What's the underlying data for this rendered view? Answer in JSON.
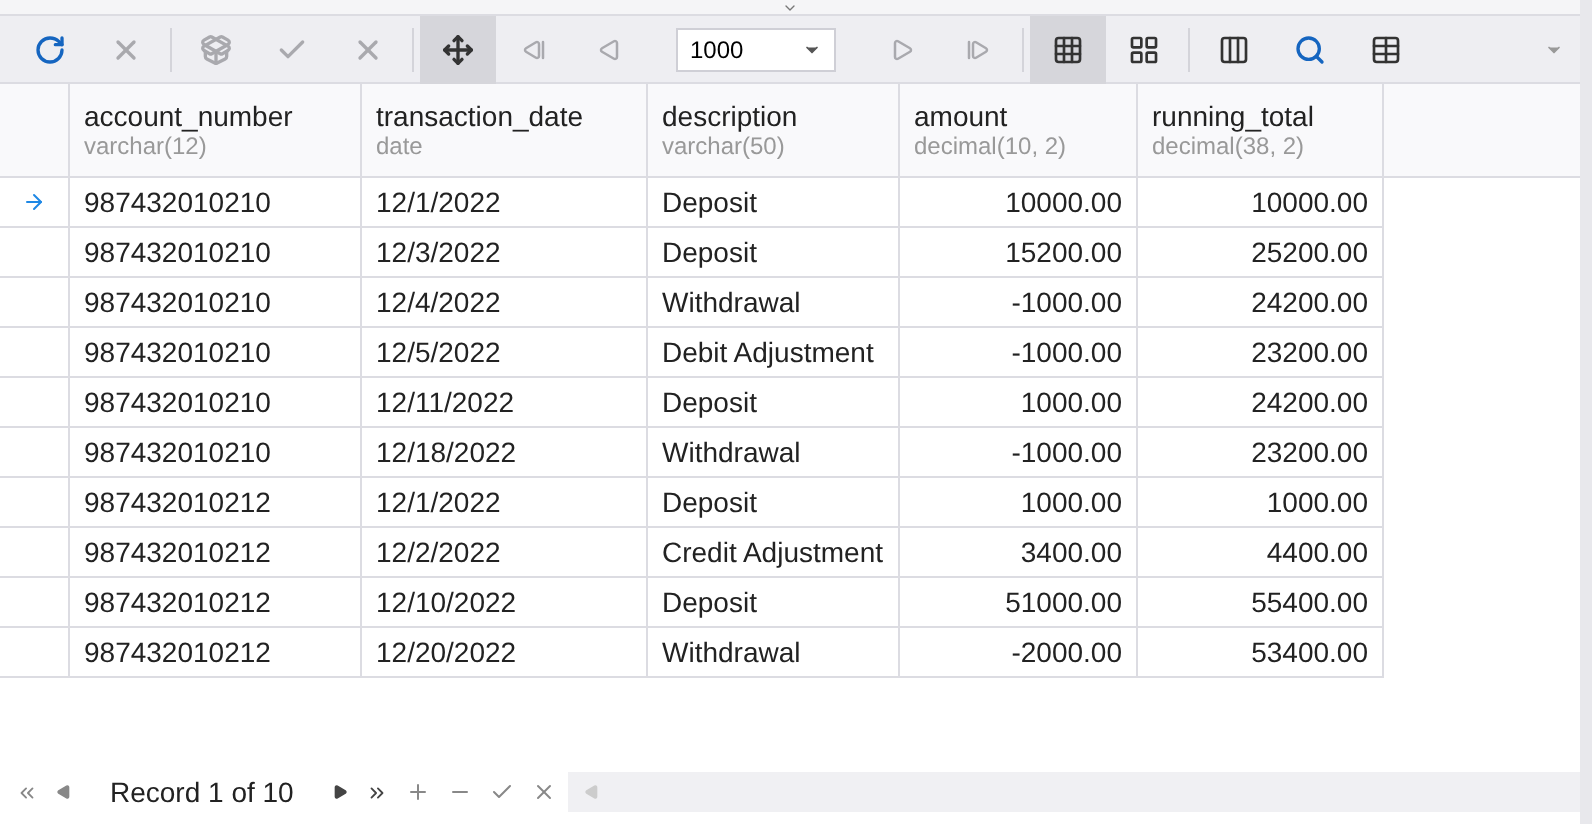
{
  "toolbar": {
    "buttons": [
      {
        "kind": "refresh",
        "disabled": false,
        "selected": false
      },
      {
        "kind": "cancel",
        "disabled": true,
        "selected": false
      },
      {
        "kind": "separator"
      },
      {
        "kind": "import",
        "disabled": true,
        "selected": false
      },
      {
        "kind": "apply",
        "disabled": true,
        "selected": false
      },
      {
        "kind": "discard",
        "disabled": true,
        "selected": false
      },
      {
        "kind": "separator"
      },
      {
        "kind": "autofit",
        "disabled": false,
        "selected": true
      },
      {
        "kind": "first",
        "disabled": true,
        "selected": false
      },
      {
        "kind": "prev",
        "disabled": true,
        "selected": false
      },
      {
        "kind": "limit",
        "value": "1000"
      },
      {
        "kind": "next",
        "disabled": true,
        "selected": false
      },
      {
        "kind": "last",
        "disabled": true,
        "selected": false
      },
      {
        "kind": "separator"
      },
      {
        "kind": "grid",
        "disabled": false,
        "selected": true
      },
      {
        "kind": "form",
        "disabled": false,
        "selected": false
      },
      {
        "kind": "separator"
      },
      {
        "kind": "columns",
        "disabled": false,
        "selected": false
      },
      {
        "kind": "find",
        "disabled": false,
        "selected": false
      },
      {
        "kind": "export",
        "disabled": false,
        "selected": false
      }
    ]
  },
  "table": {
    "columns": [
      {
        "name": "account_number",
        "type": "varchar(12)",
        "kind": "text"
      },
      {
        "name": "transaction_date",
        "type": "date",
        "kind": "text"
      },
      {
        "name": "description",
        "type": "varchar(50)",
        "kind": "text"
      },
      {
        "name": "amount",
        "type": "decimal(10, 2)",
        "kind": "number"
      },
      {
        "name": "running_total",
        "type": "decimal(38, 2)",
        "kind": "number"
      }
    ],
    "rows": [
      {
        "current": true,
        "cells": [
          "987432010210",
          "12/1/2022",
          "Deposit",
          "10000.00",
          "10000.00"
        ]
      },
      {
        "current": false,
        "cells": [
          "987432010210",
          "12/3/2022",
          "Deposit",
          "15200.00",
          "25200.00"
        ]
      },
      {
        "current": false,
        "cells": [
          "987432010210",
          "12/4/2022",
          "Withdrawal",
          "-1000.00",
          "24200.00"
        ]
      },
      {
        "current": false,
        "cells": [
          "987432010210",
          "12/5/2022",
          "Debit Adjustment",
          "-1000.00",
          "23200.00"
        ]
      },
      {
        "current": false,
        "cells": [
          "987432010210",
          "12/11/2022",
          "Deposit",
          "1000.00",
          "24200.00"
        ]
      },
      {
        "current": false,
        "cells": [
          "987432010210",
          "12/18/2022",
          "Withdrawal",
          "-1000.00",
          "23200.00"
        ]
      },
      {
        "current": false,
        "cells": [
          "987432010212",
          "12/1/2022",
          "Deposit",
          "1000.00",
          "1000.00"
        ]
      },
      {
        "current": false,
        "cells": [
          "987432010212",
          "12/2/2022",
          "Credit Adjustment",
          "3400.00",
          "4400.00"
        ]
      },
      {
        "current": false,
        "cells": [
          "987432010212",
          "12/10/2022",
          "Deposit",
          "51000.00",
          "55400.00"
        ]
      },
      {
        "current": false,
        "cells": [
          "987432010212",
          "12/20/2022",
          "Withdrawal",
          "-2000.00",
          "53400.00"
        ]
      }
    ]
  },
  "navigator": {
    "record_label": "Record 1 of 10"
  }
}
